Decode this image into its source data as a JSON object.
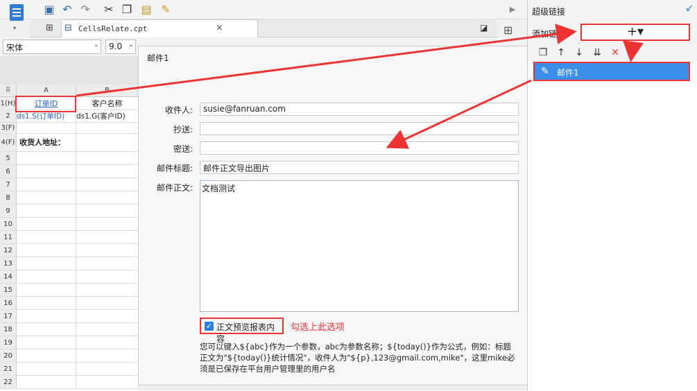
{
  "toolbar": {
    "icons": [
      "save-icon",
      "undo-icon",
      "redo-icon",
      "cut-icon",
      "copy-icon",
      "paste-icon",
      "format-brush-icon"
    ]
  },
  "tab": {
    "label": "CellsRelate.cpt",
    "close": "×"
  },
  "format": {
    "font": "宋体",
    "size": "9.0"
  },
  "grid": {
    "columns": [
      "A",
      "B"
    ],
    "rows": [
      {
        "hdr": "1(H)",
        "a": "订单ID",
        "b": "客户名称"
      },
      {
        "hdr": "2",
        "a": "ds1.S(订单ID)",
        "b": "ds1.G(客户ID)"
      },
      {
        "hdr": "3(F)",
        "a": "",
        "b": ""
      },
      {
        "hdr": "4(F)",
        "a": "收货人地址：",
        "b": ""
      },
      {
        "hdr": "5"
      },
      {
        "hdr": "6"
      },
      {
        "hdr": "7"
      },
      {
        "hdr": "8"
      },
      {
        "hdr": "9"
      },
      {
        "hdr": "10"
      },
      {
        "hdr": "11"
      },
      {
        "hdr": "12"
      },
      {
        "hdr": "13"
      },
      {
        "hdr": "14"
      },
      {
        "hdr": "15"
      },
      {
        "hdr": "16"
      },
      {
        "hdr": "17"
      },
      {
        "hdr": "18"
      },
      {
        "hdr": "19"
      },
      {
        "hdr": "20"
      },
      {
        "hdr": "21"
      },
      {
        "hdr": "22"
      }
    ]
  },
  "dialog": {
    "title": "邮件1",
    "to_label": "收件人:",
    "to_value": "susie@fanruan.com",
    "cc_label": "抄送:",
    "cc_value": "",
    "bcc_label": "密送:",
    "bcc_value": "",
    "subject_label": "邮件标题:",
    "subject_value": "邮件正文导出图片",
    "body_label": "邮件正文:",
    "body_value": "文档测试",
    "checkbox_label": "正文预览报表内容",
    "checkbox_checked": true,
    "annotation": "勾选上此选项",
    "help": "您可以键入${abc}作为一个参数，abc为参数名称；${today()}作为公式，例如：标题正文为\"${today()}统计情况\"，收件人为\"${p},123@gmail.com,mike\"，这里mike必须是已保存在平台用户管理里的用户名"
  },
  "panel": {
    "title": "超级链接",
    "add_label": "添加链接",
    "add_button": "+▾",
    "items": [
      {
        "label": "邮件1"
      }
    ]
  },
  "colors": {
    "accent": "#2a7de1",
    "highlight": "#e33333",
    "selected": "#3c8ee8"
  }
}
